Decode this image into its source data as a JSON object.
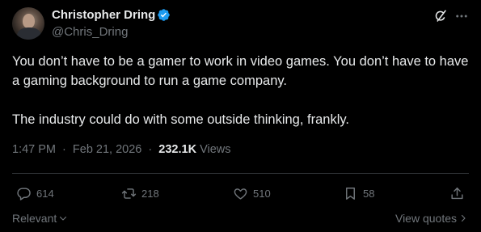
{
  "author": {
    "display_name": "Christopher Dring",
    "handle": "@Chris_Dring",
    "verified_color": "#1d9bf0"
  },
  "icons": {
    "verified": "verified-badge-icon",
    "grok": "grok-icon",
    "more": "more-icon",
    "reply": "reply-icon",
    "retweet": "retweet-icon",
    "like": "like-icon",
    "bookmark": "bookmark-icon",
    "share": "share-icon"
  },
  "tweet": {
    "paragraph_1": "You don’t have to be a gamer to work in video games. You don’t have to have a gaming background to run a game company.",
    "paragraph_2": "The industry could do with some outside thinking, frankly."
  },
  "meta": {
    "time": "1:47 PM",
    "separator_1": "·",
    "date": "Feb 21, 2026",
    "separator_2": "·",
    "views_count": "232.1K",
    "views_label": "Views"
  },
  "actions": {
    "replies": "614",
    "retweets": "218",
    "likes": "510",
    "bookmarks": "58"
  },
  "footer": {
    "sort_label": "Relevant",
    "view_quotes_label": "View quotes"
  },
  "colors": {
    "background": "#000000",
    "text_primary": "#e7e9ea",
    "text_secondary": "#71767b",
    "divider": "#2f3336"
  }
}
